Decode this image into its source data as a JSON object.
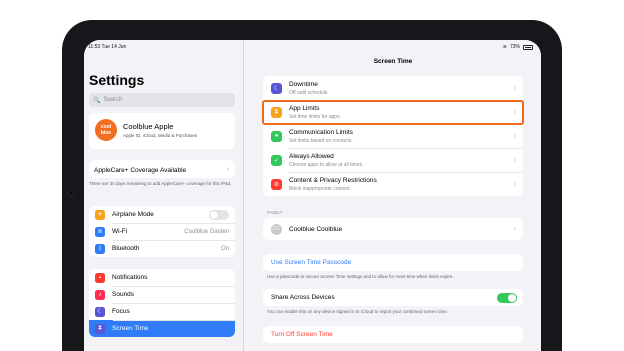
{
  "status": {
    "time": "11:53",
    "date": "Tue 14 Jun",
    "battery": "73%"
  },
  "sidebar": {
    "title": "Settings",
    "search_placeholder": "Search",
    "profile": {
      "avatar_text": "cool blue",
      "name": "Coolblue Apple",
      "subtitle": "Apple ID, iCloud, Media & Purchases"
    },
    "applecare": {
      "label": "AppleCare+ Coverage Available",
      "note": "There are 30 days remaining to add AppleCare+ coverage for this iPad."
    },
    "connectivity": [
      {
        "label": "Airplane Mode",
        "icon": "airplane-icon",
        "color": "#f7a21b",
        "value": ""
      },
      {
        "label": "Wi-Fi",
        "icon": "wifi-icon",
        "color": "#2f7cf6",
        "value": "Coolblue Gasten"
      },
      {
        "label": "Bluetooth",
        "icon": "bluetooth-icon",
        "color": "#2f7cf6",
        "value": "On"
      }
    ],
    "notifications": [
      {
        "label": "Notifications",
        "icon": "bell-icon",
        "color": "#ff3b30"
      },
      {
        "label": "Sounds",
        "icon": "speaker-icon",
        "color": "#ff2d55"
      },
      {
        "label": "Focus",
        "icon": "moon-icon",
        "color": "#5856d6"
      },
      {
        "label": "Screen Time",
        "icon": "hourglass-icon",
        "color": "#5856d6"
      }
    ]
  },
  "main": {
    "title": "Screen Time",
    "limits": [
      {
        "title": "Downtime",
        "subtitle": "Off until schedule",
        "icon": "moon-icon",
        "color": "#5856d6"
      },
      {
        "title": "App Limits",
        "subtitle": "Set time limits for apps.",
        "icon": "hourglass-icon",
        "color": "#f7a21b"
      },
      {
        "title": "Communication Limits",
        "subtitle": "Set limits based on contacts.",
        "icon": "person-bubble-icon",
        "color": "#34c759"
      },
      {
        "title": "Always Allowed",
        "subtitle": "Choose apps to allow at all times.",
        "icon": "checkmark-icon",
        "color": "#34c759"
      },
      {
        "title": "Content & Privacy Restrictions",
        "subtitle": "Block inappropriate content.",
        "icon": "no-entry-icon",
        "color": "#ff3b30"
      }
    ],
    "family_label": "FAMILY",
    "family_member": {
      "initials": "CC",
      "name": "Coolblue Coolblue"
    },
    "passcode_link": "Use Screen Time Passcode",
    "passcode_note": "Use a passcode to secure Screen Time settings and to allow for more time when limits expire.",
    "share_label": "Share Across Devices",
    "share_note": "You can enable this on any device signed in to iCloud to report your combined screen time.",
    "turn_off": "Turn Off Screen Time"
  }
}
